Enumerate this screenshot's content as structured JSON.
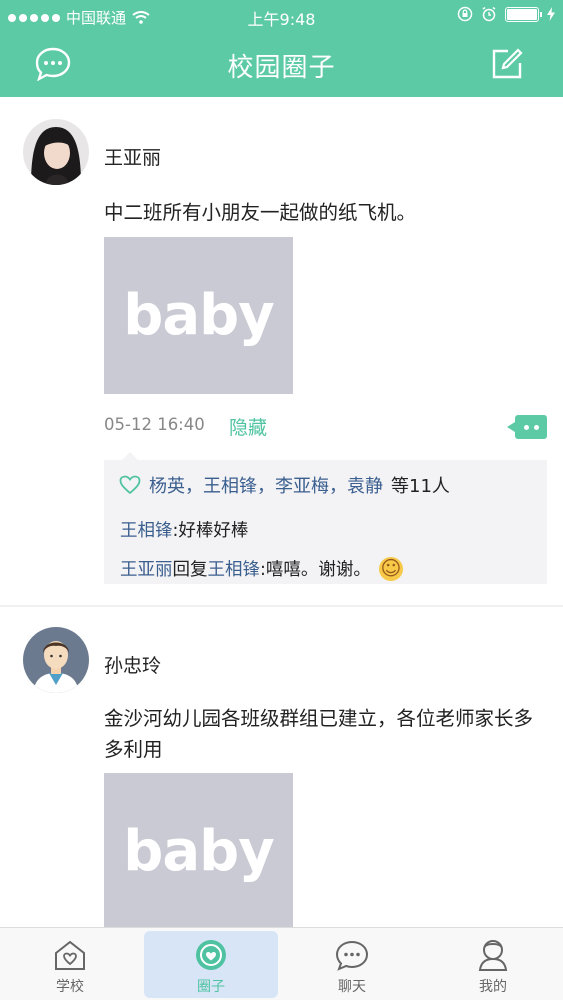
{
  "status_bar": {
    "carrier": "中国联通",
    "time": "上午9:48"
  },
  "nav": {
    "title": "校园圈子",
    "left_icon": "chat-bubble-icon",
    "right_icon": "compose-icon"
  },
  "posts": [
    {
      "author": "王亚丽",
      "content": "中二班所有小朋友一起做的纸飞机。",
      "image_text": "baby",
      "time": "05-12 16:40",
      "hide_label": "隐藏",
      "likes": {
        "names": "杨英，王相锋，李亚梅，袁静",
        "suffix": "等11人"
      },
      "comments": [
        {
          "from": "王相锋",
          "text": ":好棒好棒"
        },
        {
          "from": "王亚丽",
          "reply_word": "回复",
          "to": "王相锋",
          "text": ":嘻嘻。谢谢。"
        }
      ]
    },
    {
      "author": "孙忠玲",
      "content": "金沙河幼儿园各班级群组已建立，各位老师家长多多利用",
      "image_text": "baby"
    }
  ],
  "tabs": [
    {
      "label": "学校",
      "icon": "home-heart-icon",
      "active": false
    },
    {
      "label": "圈子",
      "icon": "circle-heart-icon",
      "active": true
    },
    {
      "label": "聊天",
      "icon": "chat-icon",
      "active": false
    },
    {
      "label": "我的",
      "icon": "profile-icon",
      "active": false
    }
  ],
  "colors": {
    "brand": "#5dcaa6",
    "link_name": "#3b5f8f",
    "accent_text": "#4fc3a1"
  }
}
